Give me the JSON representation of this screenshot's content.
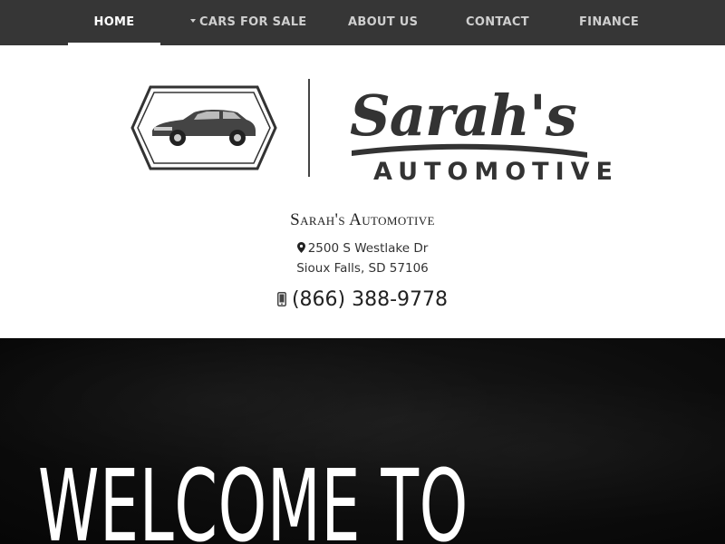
{
  "nav": {
    "items": [
      {
        "label": "HOME",
        "active": true
      },
      {
        "label": "CARS FOR SALE",
        "has_dropdown": true
      },
      {
        "label": "ABOUT US"
      },
      {
        "label": "CONTACT"
      },
      {
        "label": "FINANCE"
      }
    ]
  },
  "logo": {
    "script_text": "Sarah's",
    "sub_text": "AUTOMOTIVE",
    "badge_icon": "car-badge-icon"
  },
  "business": {
    "name": "Sarah's Automotive",
    "address_line1": "2500 S Westlake Dr",
    "address_line2": "Sioux Falls, SD 57106",
    "phone": "(866) 388-9778"
  },
  "hero": {
    "title": "WELCOME TO"
  },
  "colors": {
    "nav_bg": "#363636",
    "nav_text": "#cfcfcf",
    "nav_active": "#ffffff",
    "hero_bg": "#0d0d0d"
  }
}
